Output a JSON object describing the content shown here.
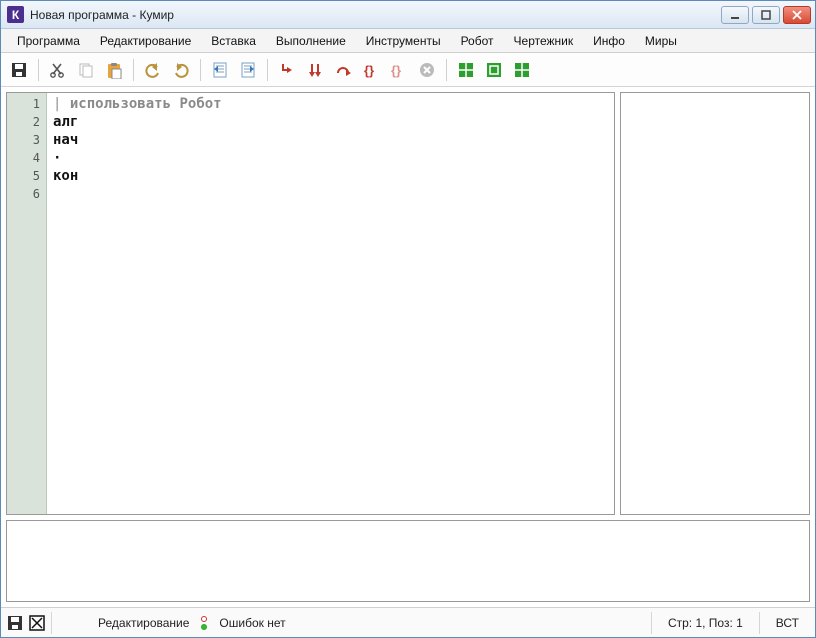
{
  "titlebar": {
    "title": "Новая программа - Кумир",
    "app_letter": "К"
  },
  "menu": {
    "items": [
      "Программа",
      "Редактирование",
      "Вставка",
      "Выполнение",
      "Инструменты",
      "Робот",
      "Чертежник",
      "Инфо",
      "Миры"
    ]
  },
  "toolbar_icons": {
    "save": "save-icon",
    "cut": "cut-icon",
    "copy": "copy-icon",
    "paste": "paste-icon",
    "undo": "undo-icon",
    "redo": "redo-icon",
    "doc_left": "indent-left-icon",
    "doc_right": "indent-right-icon",
    "run": "run-icon",
    "step": "step-icon",
    "step_over": "step-over-icon",
    "step_into": "step-into-icon",
    "step_out": "step-out-icon",
    "stop": "stop-icon",
    "grid1": "grid-green-icon",
    "grid2": "square-green-icon",
    "grid3": "grid-green2-icon"
  },
  "editor": {
    "lines": [
      {
        "n": 1,
        "html": "<span class='cursor-bar'>|</span> <span class='kw-use'>использовать</span> <span class='kw-use'>Робот</span>"
      },
      {
        "n": 2,
        "html": "<span class='kw'>алг</span>"
      },
      {
        "n": 3,
        "html": "<span class='kw'>нач</span>"
      },
      {
        "n": 4,
        "html": "<span class='kw'>·</span>"
      },
      {
        "n": 5,
        "html": "<span class='kw'>кон</span>"
      },
      {
        "n": 6,
        "html": ""
      }
    ]
  },
  "status": {
    "mode": "Редактирование",
    "errors": "Ошибок нет",
    "position": "Стр: 1, Поз: 1",
    "insert": "ВСТ"
  }
}
